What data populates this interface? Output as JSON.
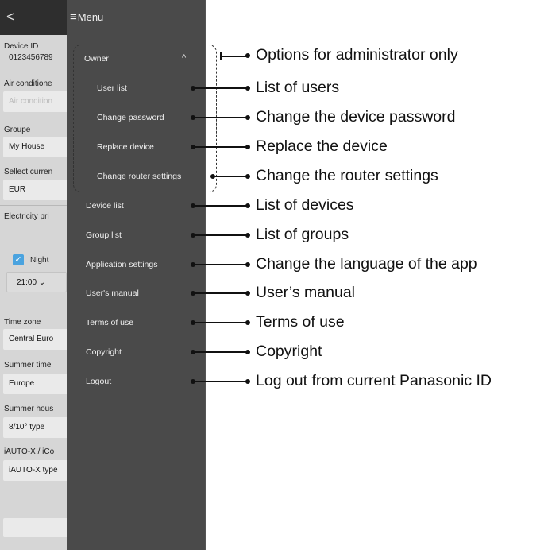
{
  "background": {
    "labels": [
      {
        "text": "Device ID"
      },
      {
        "text": "Air conditione"
      },
      {
        "text": "Groupe"
      },
      {
        "text": "Sellect curren"
      },
      {
        "text": "Electricity pri"
      },
      {
        "text": "Time zone"
      },
      {
        "text": "Summer time"
      },
      {
        "text": "Summer hous"
      },
      {
        "text": "iAUTO-X / iCo"
      }
    ],
    "device_id_value": "0123456789",
    "fields": [
      {
        "text": "Air condition",
        "dim": true
      },
      {
        "text": "My House"
      },
      {
        "text": "EUR"
      },
      {
        "text": "21:00   ⌄"
      },
      {
        "text": "Central Euro"
      },
      {
        "text": "Europe"
      },
      {
        "text": "8/10° type"
      },
      {
        "text": "iAUTO-X type"
      },
      {
        "text": ""
      }
    ],
    "night_label": "Night",
    "night_checked": true
  },
  "menu": {
    "title": "Menu",
    "items": [
      {
        "label": "Owner"
      },
      {
        "label": "User list"
      },
      {
        "label": "Change password"
      },
      {
        "label": "Replace device"
      },
      {
        "label": "Change router settings"
      },
      {
        "label": "Device list"
      },
      {
        "label": "Group list"
      },
      {
        "label": "Application settings"
      },
      {
        "label": "User's manual"
      },
      {
        "label": "Terms of use"
      },
      {
        "label": "Copyright"
      },
      {
        "label": "Logout"
      }
    ]
  },
  "callouts": [
    {
      "text": "Options for administrator only"
    },
    {
      "text": "List of users"
    },
    {
      "text": "Change the device password"
    },
    {
      "text": "Replace the device"
    },
    {
      "text": "Change the router settings"
    },
    {
      "text": "List of devices"
    },
    {
      "text": "List of groups"
    },
    {
      "text": "Change the language of the app"
    },
    {
      "text": "User’s manual"
    },
    {
      "text": "Terms of use"
    },
    {
      "text": "Copyright"
    },
    {
      "text": "Log out from current Panasonic ID"
    }
  ]
}
